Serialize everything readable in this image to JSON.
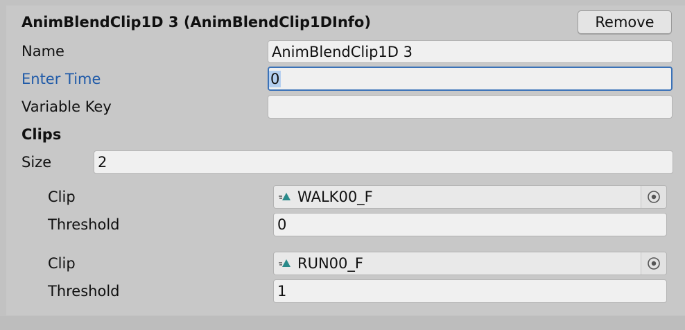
{
  "header": {
    "title": "AnimBlendClip1D 3 (AnimBlendClip1DInfo)",
    "remove_label": "Remove"
  },
  "fields": {
    "name_label": "Name",
    "name_value": "AnimBlendClip1D 3",
    "enter_time_label": "Enter Time",
    "enter_time_value": "0",
    "variable_key_label": "Variable Key",
    "variable_key_value": ""
  },
  "clips": {
    "section_label": "Clips",
    "size_label": "Size",
    "size_value": "2",
    "items": [
      {
        "clip_label": "Clip",
        "clip_value": "WALK00_F",
        "threshold_label": "Threshold",
        "threshold_value": "0"
      },
      {
        "clip_label": "Clip",
        "clip_value": "RUN00_F",
        "threshold_label": "Threshold",
        "threshold_value": "1"
      }
    ]
  },
  "icons": {
    "clip_icon": "animation-clip-icon",
    "picker_icon": "object-picker-icon"
  },
  "colors": {
    "focused_label": "#1f5aa8",
    "focus_border": "#3a72b8",
    "clip_icon": "#2a8a8a"
  }
}
